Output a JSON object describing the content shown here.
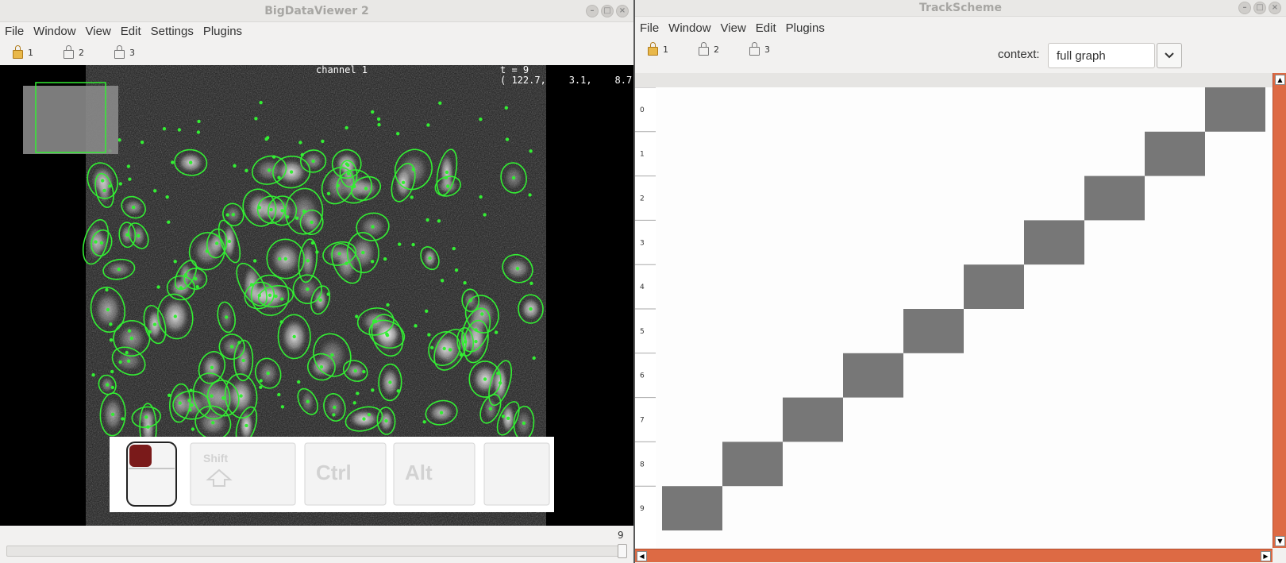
{
  "bdv": {
    "title": "BigDataViewer 2",
    "menu": [
      "File",
      "Window",
      "View",
      "Edit",
      "Settings",
      "Plugins"
    ],
    "locks": [
      "1",
      "2",
      "3"
    ],
    "overlay": {
      "channel": "channel 1",
      "time": "t = 9",
      "coords": "( 122.7,    3.1,    8.7)"
    },
    "keys": {
      "shift": "Shift",
      "ctrl": "Ctrl",
      "alt": "Alt"
    },
    "timepoint": {
      "label": "9",
      "value": 9,
      "max": 9
    }
  },
  "trackscheme": {
    "title": "TrackScheme",
    "menu": [
      "File",
      "Window",
      "View",
      "Edit",
      "Plugins"
    ],
    "locks": [
      "1",
      "2",
      "3"
    ],
    "context_label": "context:",
    "context_value": "full graph",
    "row_labels": [
      "0",
      "1",
      "2",
      "3",
      "4",
      "5",
      "6",
      "7",
      "8",
      "9"
    ]
  },
  "colors": {
    "spot": "#33ee33",
    "block": "#777777",
    "scroll_accent": "#dd6a44"
  }
}
